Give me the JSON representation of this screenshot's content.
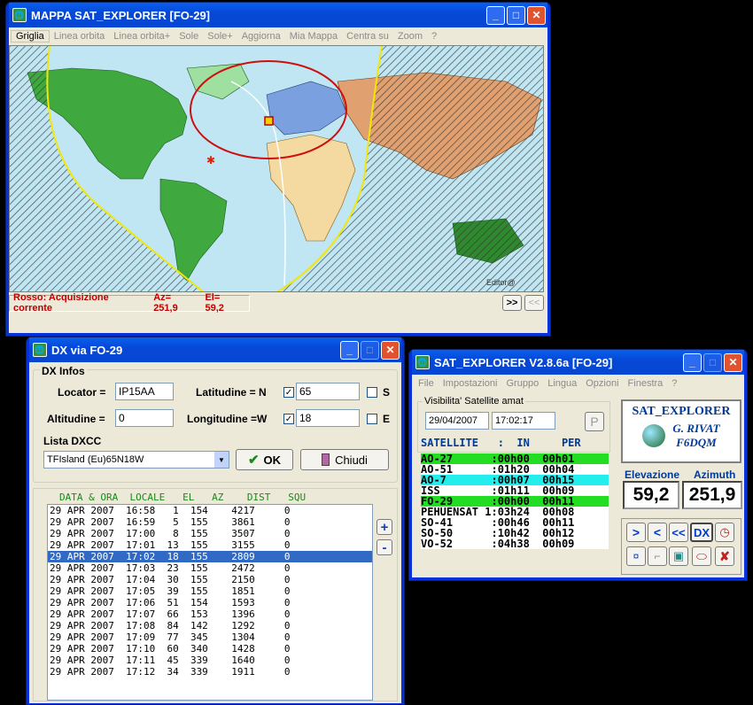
{
  "map_window": {
    "title": "MAPPA SAT_EXPLORER [FO-29]",
    "menu": [
      "Griglia",
      "Linea orbita",
      "Linea orbita+",
      "Sole",
      "Sole+",
      "Aggiorna",
      "Mia Mappa",
      "Centra su",
      "Zoom",
      "?"
    ],
    "status": {
      "prefix": "Rosso: Acquisizione corrente",
      "az": "Az= 251,9",
      "el": "El= 59,2"
    },
    "next_label": ">>",
    "prev_label": "<<",
    "map_credit": "Editor@"
  },
  "dx_window": {
    "title": "DX via FO-29",
    "group_label": "DX Infos",
    "locator_label": "Locator =",
    "locator": "IP15AA",
    "lat_label": "Latitudine = N",
    "lat": "65",
    "lat_s": "S",
    "alt_label": "Altitudine =",
    "alt": "0",
    "lon_label": "Longitudine =W",
    "lon": "18",
    "lon_e": "E",
    "dxcc_label": "Lista DXCC",
    "dxcc": "TFIsland (Eu)65N18W",
    "ok": "OK",
    "close": "Chiudi",
    "headers": "DATA & ORA  LOCALE   EL   AZ    DIST   SQU",
    "rows": [
      "29 APR 2007  16:58   1  154    4217     0",
      "29 APR 2007  16:59   5  155    3861     0",
      "29 APR 2007  17:00   8  155    3507     0",
      "29 APR 2007  17:01  13  155    3155     0",
      "29 APR 2007  17:02  18  155    2809     0",
      "29 APR 2007  17:03  23  155    2472     0",
      "29 APR 2007  17:04  30  155    2150     0",
      "29 APR 2007  17:05  39  155    1851     0",
      "29 APR 2007  17:06  51  154    1593     0",
      "29 APR 2007  17:07  66  153    1396     0",
      "29 APR 2007  17:08  84  142    1292     0",
      "29 APR 2007  17:09  77  345    1304     0",
      "29 APR 2007  17:10  60  340    1428     0",
      "29 APR 2007  17:11  45  339    1640     0",
      "29 APR 2007  17:12  34  339    1911     0"
    ],
    "plus": "+",
    "minus": "-"
  },
  "main_window": {
    "title": "SAT_EXPLORER V2.8.6a  [FO-29]",
    "menu": [
      "File",
      "Impostazioni",
      "Gruppo",
      "Lingua",
      "Opzioni",
      "Finestra",
      "?"
    ],
    "vis_label": "Visibilita' Satellite  amat",
    "date": "29/04/2007",
    "time": "17:02:17",
    "p_btn": "P",
    "sat_header": "SATELLITE   :  IN     PER",
    "sats": [
      {
        "text": "AO-27      :00h00  00h01",
        "bg": "#22dd22"
      },
      {
        "text": "AO-51      :01h20  00h04",
        "bg": "#ffffff"
      },
      {
        "text": "AO-7       :00h07  00h15",
        "bg": "#22eeee"
      },
      {
        "text": "ISS        :01h11  00h09",
        "bg": "#ffffff"
      },
      {
        "text": "FO-29      :00h00  00h11",
        "bg": "#22dd22"
      },
      {
        "text": "PEHUENSAT 1:03h24  00h08",
        "bg": "#ffffff"
      },
      {
        "text": "SO-41      :00h46  00h11",
        "bg": "#ffffff"
      },
      {
        "text": "SO-50      :10h42  00h12",
        "bg": "#ffffff"
      },
      {
        "text": "VO-52      :04h38  00h09",
        "bg": "#ffffff"
      }
    ],
    "logo_title": "SAT_EXPLORER",
    "logo_author": "G. RIVAT",
    "logo_call": "F6DQM",
    "elev_label": "Elevazione",
    "azim_label": "Azimuth",
    "elev": "59,2",
    "azim": "251,9",
    "buttons": [
      ">",
      "<",
      "<<",
      "DX"
    ]
  }
}
